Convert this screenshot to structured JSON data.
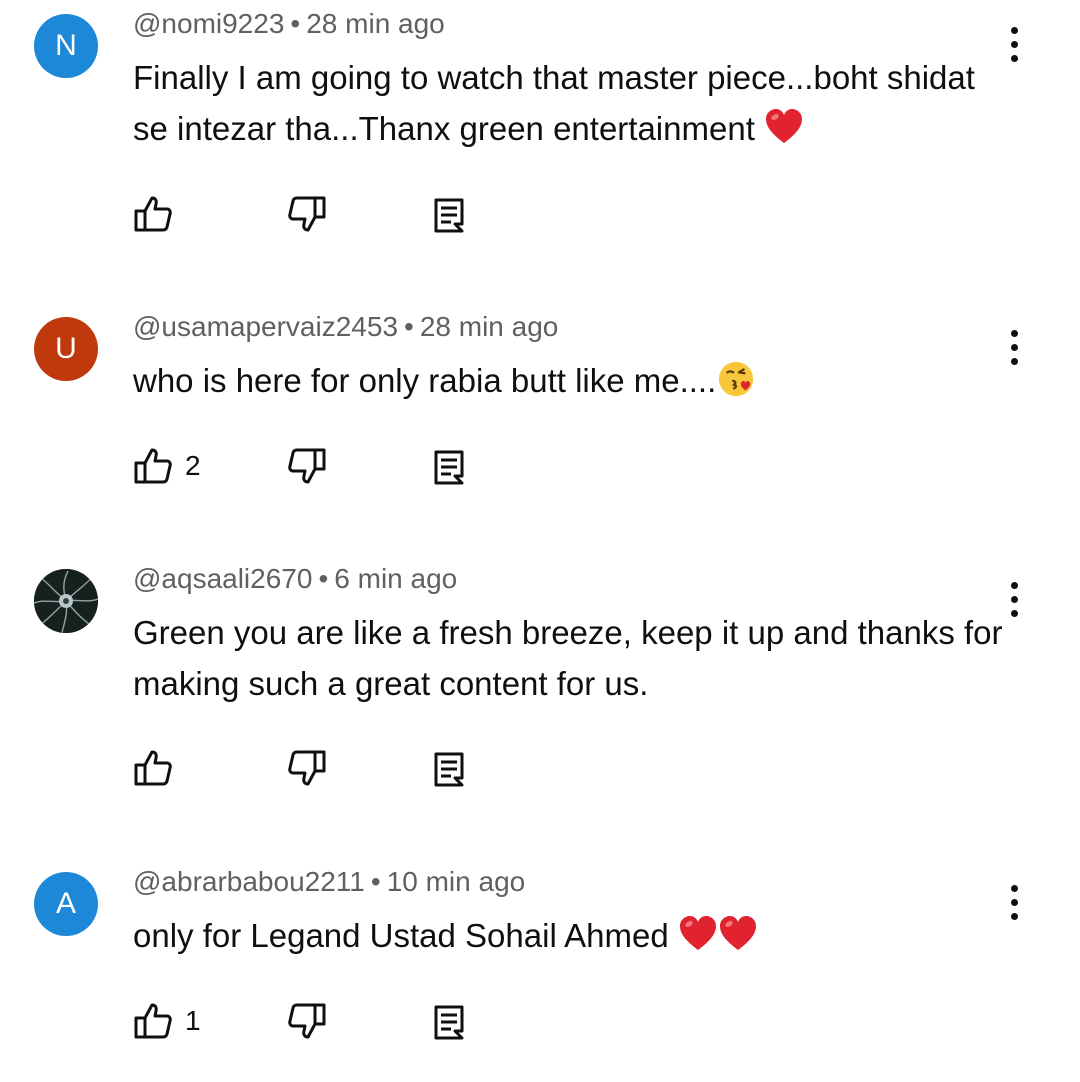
{
  "comments": [
    {
      "avatar_letter": "N",
      "avatar_color": "#1d88d8",
      "username": "@nomi9223",
      "separator": "•",
      "time": "28 min ago",
      "text": "Finally I am going to watch that master piece...boht shidat se intezar tha...Thanx green entertainment",
      "emojis": [
        "heart"
      ],
      "likes": ""
    },
    {
      "avatar_letter": "U",
      "avatar_color": "#c0390d",
      "username": "@usamapervaiz2453",
      "separator": "•",
      "time": "28 min ago",
      "text": "who is here for only rabia butt like me....",
      "emojis": [
        "kissing-face-with-heart"
      ],
      "likes": "2"
    },
    {
      "avatar_letter": "",
      "avatar_color": "#1c2a2c",
      "username": "@aqsaali2670",
      "separator": "•",
      "time": "6 min ago",
      "text": "Green you are like a fresh breeze, keep it up and thanks for making such a great content for us.",
      "emojis": [],
      "likes": ""
    },
    {
      "avatar_letter": "A",
      "avatar_color": "#1d88d8",
      "username": "@abrarbabou2211",
      "separator": "•",
      "time": "10 min ago",
      "text": "only for Legand Ustad Sohail Ahmed",
      "emojis": [
        "heart",
        "heart"
      ],
      "likes": "1"
    }
  ],
  "icons": {
    "like": "thumbs-up-icon",
    "dislike": "thumbs-down-icon",
    "reply": "reply-comment-icon",
    "menu": "more-vertical-icon"
  }
}
